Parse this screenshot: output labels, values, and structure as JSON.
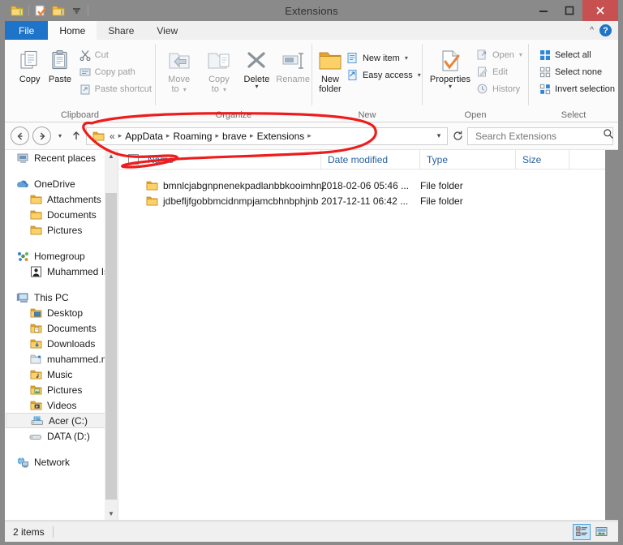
{
  "window": {
    "title": "Extensions",
    "minimize_label": "Minimize",
    "maximize_label": "Maximize",
    "close_label": "Close"
  },
  "quick_access": {
    "items": [
      {
        "name": "folder-icon",
        "label": "Properties"
      },
      {
        "name": "new-folder-icon",
        "label": "New folder"
      },
      {
        "name": "folder-up-icon",
        "label": "Up"
      },
      {
        "name": "chevron-down-icon",
        "label": "Customize Quick Access Toolbar"
      }
    ]
  },
  "ribbon": {
    "tabs": [
      {
        "id": "file",
        "label": "File"
      },
      {
        "id": "home",
        "label": "Home"
      },
      {
        "id": "share",
        "label": "Share"
      },
      {
        "id": "view",
        "label": "View"
      }
    ],
    "active_tab": "Home",
    "collapse_label": "^",
    "help_label": "?",
    "groups": [
      {
        "label": "Clipboard",
        "big": [
          {
            "label": "Copy",
            "icon": "copy-icon",
            "disabled": false
          },
          {
            "label": "Paste",
            "icon": "paste-icon",
            "disabled": false
          }
        ],
        "small": [
          {
            "label": "Cut",
            "icon": "scissors-icon",
            "disabled": true
          },
          {
            "label": "Copy path",
            "icon": "copy-path-icon",
            "disabled": true
          },
          {
            "label": "Paste shortcut",
            "icon": "paste-shortcut-icon",
            "disabled": true
          }
        ]
      },
      {
        "label": "Organize",
        "big": [
          {
            "label_line1": "Move",
            "label_line2": "to",
            "icon": "move-to-icon",
            "disabled": true,
            "has_caret": true
          },
          {
            "label_line1": "Copy",
            "label_line2": "to",
            "icon": "copy-to-icon",
            "disabled": true,
            "has_caret": true
          },
          {
            "label_line1": "Delete",
            "label_line2": "",
            "icon": "delete-icon",
            "disabled": false,
            "has_caret": true
          },
          {
            "label_line1": "Rename",
            "label_line2": "",
            "icon": "rename-icon",
            "disabled": true,
            "has_caret": false
          }
        ]
      },
      {
        "label": "New",
        "big": [
          {
            "label_line1": "New",
            "label_line2": "folder",
            "icon": "new-folder-icon",
            "disabled": false
          }
        ],
        "small": [
          {
            "label": "New item",
            "icon": "new-item-icon",
            "disabled": false,
            "has_caret": true
          },
          {
            "label": "Easy access",
            "icon": "easy-access-icon",
            "disabled": false,
            "has_caret": true
          }
        ]
      },
      {
        "label": "Open",
        "big": [
          {
            "label_line1": "Properties",
            "label_line2": "",
            "icon": "properties-icon",
            "disabled": false,
            "has_caret": true
          }
        ],
        "small": [
          {
            "label": "Open",
            "icon": "open-icon",
            "disabled": true,
            "has_caret": true
          },
          {
            "label": "Edit",
            "icon": "edit-icon",
            "disabled": true
          },
          {
            "label": "History",
            "icon": "history-icon",
            "disabled": true
          }
        ]
      },
      {
        "label": "Select",
        "small": [
          {
            "label": "Select all",
            "icon": "select-all-icon",
            "disabled": false
          },
          {
            "label": "Select none",
            "icon": "select-none-icon",
            "disabled": false
          },
          {
            "label": "Invert selection",
            "icon": "invert-selection-icon",
            "disabled": false
          }
        ]
      }
    ]
  },
  "address_bar": {
    "back_label": "Back",
    "forward_label": "Forward",
    "recent_label": "Recent locations",
    "up_label": "Up",
    "breadcrumbs": [
      "AppData",
      "Roaming",
      "brave",
      "Extensions"
    ],
    "prefix": "«",
    "dropdown_label": "Previous locations",
    "refresh_label": "Refresh",
    "search": {
      "placeholder": "Search Extensions",
      "value": "",
      "icon": "search-icon"
    }
  },
  "nav_pane": {
    "items": [
      {
        "label": "Recent places",
        "icon": "recent-places-icon",
        "indent": false,
        "selected": false,
        "gap_before": false
      },
      {
        "label": "OneDrive",
        "icon": "onedrive-icon",
        "indent": false,
        "selected": false,
        "gap_before": true
      },
      {
        "label": "Attachments",
        "icon": "folder-icon",
        "indent": true,
        "selected": false,
        "gap_before": false
      },
      {
        "label": "Documents",
        "icon": "folder-icon",
        "indent": true,
        "selected": false,
        "gap_before": false
      },
      {
        "label": "Pictures",
        "icon": "folder-icon",
        "indent": true,
        "selected": false,
        "gap_before": false
      },
      {
        "label": "Homegroup",
        "icon": "homegroup-icon",
        "indent": false,
        "selected": false,
        "gap_before": true
      },
      {
        "label": "Muhammed Ism",
        "icon": "user-icon",
        "indent": true,
        "selected": false,
        "gap_before": false
      },
      {
        "label": "This PC",
        "icon": "this-pc-icon",
        "indent": false,
        "selected": false,
        "gap_before": true
      },
      {
        "label": "Desktop",
        "icon": "desktop-folder-icon",
        "indent": true,
        "selected": false,
        "gap_before": false
      },
      {
        "label": "Documents",
        "icon": "documents-folder-icon",
        "indent": true,
        "selected": false,
        "gap_before": false
      },
      {
        "label": "Downloads",
        "icon": "downloads-folder-icon",
        "indent": true,
        "selected": false,
        "gap_before": false
      },
      {
        "label": "muhammed.mo",
        "icon": "network-folder-icon",
        "indent": true,
        "selected": false,
        "gap_before": false
      },
      {
        "label": "Music",
        "icon": "music-folder-icon",
        "indent": true,
        "selected": false,
        "gap_before": false
      },
      {
        "label": "Pictures",
        "icon": "pictures-folder-icon",
        "indent": true,
        "selected": false,
        "gap_before": false
      },
      {
        "label": "Videos",
        "icon": "videos-folder-icon",
        "indent": true,
        "selected": false,
        "gap_before": false
      },
      {
        "label": "Acer (C:)",
        "icon": "local-disk-icon",
        "indent": true,
        "selected": true,
        "gap_before": false
      },
      {
        "label": "DATA (D:)",
        "icon": "disk-icon",
        "indent": true,
        "selected": false,
        "gap_before": false
      },
      {
        "label": "Network",
        "icon": "network-icon",
        "indent": false,
        "selected": false,
        "gap_before": true
      }
    ],
    "scroll_up_label": "Scroll up",
    "scroll_down_label": "Scroll down"
  },
  "file_list": {
    "columns": [
      "Name",
      "Date modified",
      "Type",
      "Size"
    ],
    "select_all_checkbox": false,
    "rows": [
      {
        "name": "bmnlcjabgnpnenekpadlanbbkooimhnj",
        "date_modified": "2018-02-06 05:46 ...",
        "type": "File folder",
        "size": "",
        "icon": "folder-icon"
      },
      {
        "name": "jdbefljfgobbmcidnmpjamcbhnbphjnb",
        "date_modified": "2017-12-11 06:42 ...",
        "type": "File folder",
        "size": "",
        "icon": "folder-icon"
      }
    ]
  },
  "status_bar": {
    "item_count": "2 items",
    "views": [
      {
        "name": "details-view-button",
        "label": "Details view",
        "selected": true
      },
      {
        "name": "large-icons-view-button",
        "label": "Large icons view",
        "selected": false
      }
    ]
  },
  "annotation": {
    "type": "hand-drawn-ellipse",
    "color": "#ee1c1c",
    "target": "breadcrumb-path"
  },
  "colors": {
    "accent": "#1e74c8",
    "titlebar": "#8a8a8a",
    "close_button": "#c75050",
    "header_text": "#27609e",
    "annotation_red": "#ee1c1c"
  }
}
